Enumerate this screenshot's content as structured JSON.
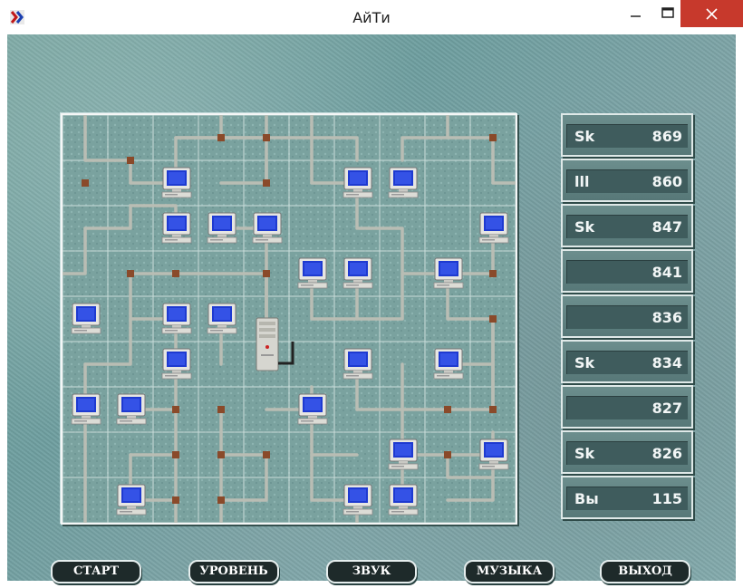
{
  "window": {
    "title": "АйТи"
  },
  "icons": {
    "app": "app-icon",
    "minimize": "minimize-icon",
    "maximize": "maximize-icon",
    "close": "close-icon"
  },
  "scores": [
    {
      "name": "Sk",
      "value": "869"
    },
    {
      "name": "lll",
      "value": "860"
    },
    {
      "name": "Sk",
      "value": "847"
    },
    {
      "name": "",
      "value": "841"
    },
    {
      "name": "",
      "value": "836"
    },
    {
      "name": "Sk",
      "value": "834"
    },
    {
      "name": "",
      "value": "827"
    },
    {
      "name": "Sk",
      "value": "826"
    },
    {
      "name": "Вы",
      "value": "115"
    }
  ],
  "buttons": {
    "start": "СТАРТ",
    "level": "УРОВЕНЬ",
    "sound": "ЗВУК",
    "music": "МУЗЫКА",
    "exit": "ВЫХОД"
  },
  "board": {
    "cols": 10,
    "rows": 9,
    "computers": [
      [
        2,
        1
      ],
      [
        6,
        1
      ],
      [
        7,
        1
      ],
      [
        2,
        2
      ],
      [
        3,
        2
      ],
      [
        4,
        2
      ],
      [
        9,
        2
      ],
      [
        5,
        3
      ],
      [
        6,
        3
      ],
      [
        8,
        3
      ],
      [
        0,
        4
      ],
      [
        2,
        4
      ],
      [
        3,
        4
      ],
      [
        2,
        5
      ],
      [
        6,
        5
      ],
      [
        8,
        5
      ],
      [
        0,
        6
      ],
      [
        1,
        6
      ],
      [
        5,
        6
      ],
      [
        7,
        7
      ],
      [
        9,
        7
      ],
      [
        1,
        8
      ],
      [
        6,
        8
      ],
      [
        7,
        8
      ]
    ],
    "server": [
      4,
      5
    ]
  }
}
